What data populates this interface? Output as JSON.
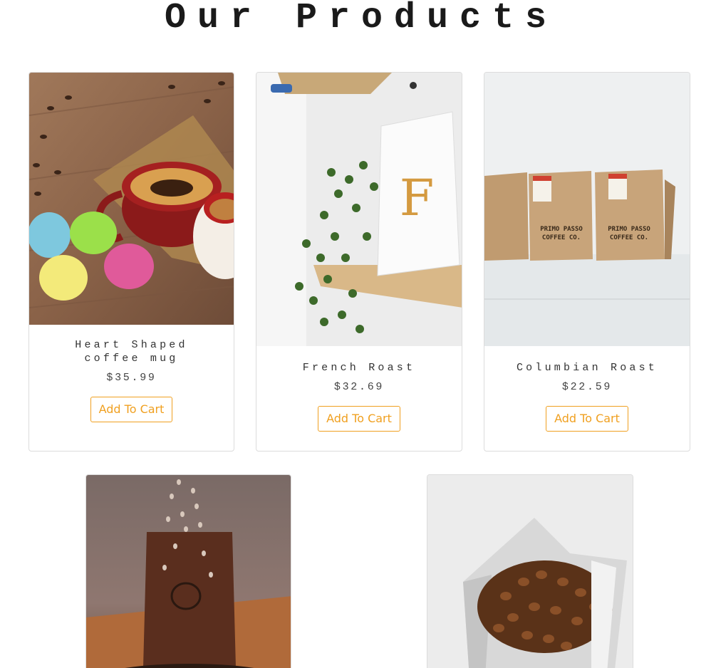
{
  "page": {
    "title": "Our Products"
  },
  "theme": {
    "accent": "#f0a020",
    "border": "#dcdcdc",
    "text": "#333333"
  },
  "products": [
    {
      "name": "Heart Shaped coffee mug",
      "price": "$35.99",
      "button_label": "Add To Cart",
      "image": "heart-mug-macarons-photo"
    },
    {
      "name": "French Roast",
      "price": "$32.69",
      "button_label": "Add To Cart",
      "image": "coffee-bag-plant-shelf-photo"
    },
    {
      "name": "Columbian Roast",
      "price": "$22.59",
      "button_label": "Add To Cart",
      "image": "kraft-coffee-bags-photo",
      "image_bag_label": "PRIMO PASSO COFFEE CO."
    },
    {
      "image": "falling-beans-brown-bag-photo"
    },
    {
      "image": "open-bag-coffee-beans-photo"
    }
  ]
}
